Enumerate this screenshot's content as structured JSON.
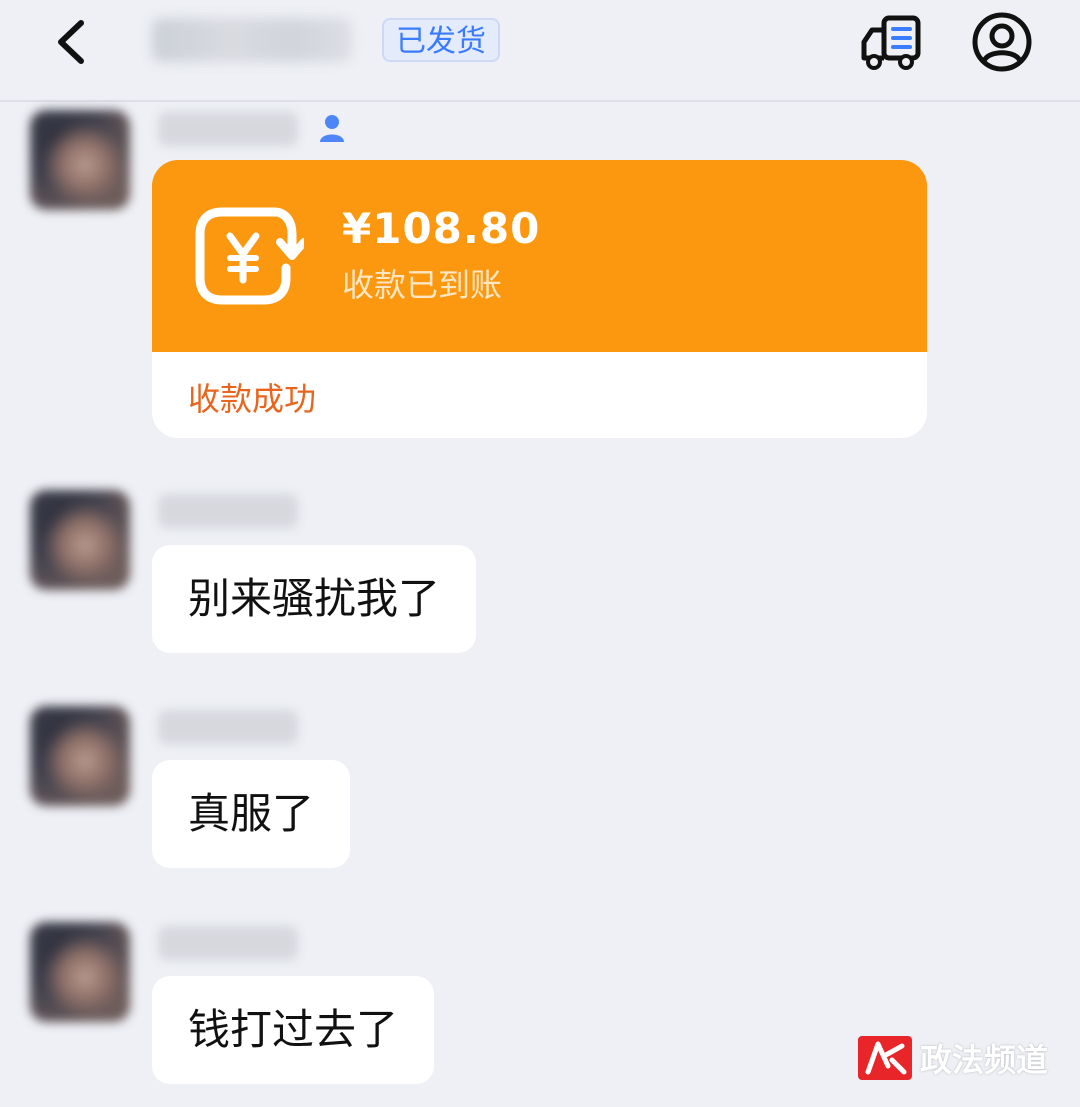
{
  "header": {
    "status_badge": "已发货"
  },
  "payment": {
    "amount": "¥108.80",
    "status": "收款已到账",
    "result": "收款成功"
  },
  "messages": [
    {
      "text": "别来骚扰我了"
    },
    {
      "text": "真服了"
    },
    {
      "text": "钱打过去了"
    }
  ],
  "watermark": {
    "text": "政法频道"
  },
  "colors": {
    "page_background": "#eef0f5",
    "payment_orange": "#fb980f",
    "payment_result_text": "#e7651c",
    "badge_blue": "#3a7bff",
    "bubble_white": "#ffffff"
  },
  "icons": {
    "back": "chevron-left-icon",
    "logistics": "truck-icon",
    "profile": "user-circle-icon",
    "payment": "yuan-refund-icon",
    "verified": "verified-user-icon"
  }
}
